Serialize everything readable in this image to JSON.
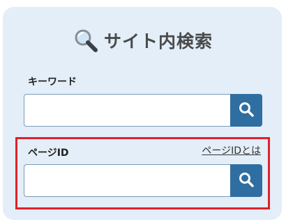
{
  "title": "サイト内検索",
  "keyword": {
    "label": "キーワード",
    "value": "",
    "search_icon": "search-icon"
  },
  "page_id": {
    "label": "ページID",
    "help_link": "ページIDとは",
    "value": "",
    "search_icon": "search-icon"
  },
  "colors": {
    "panel_background": "#e3eef8",
    "button": "#2f6ea1",
    "highlight": "#e0202a",
    "title_text": "#4a4a4a"
  }
}
